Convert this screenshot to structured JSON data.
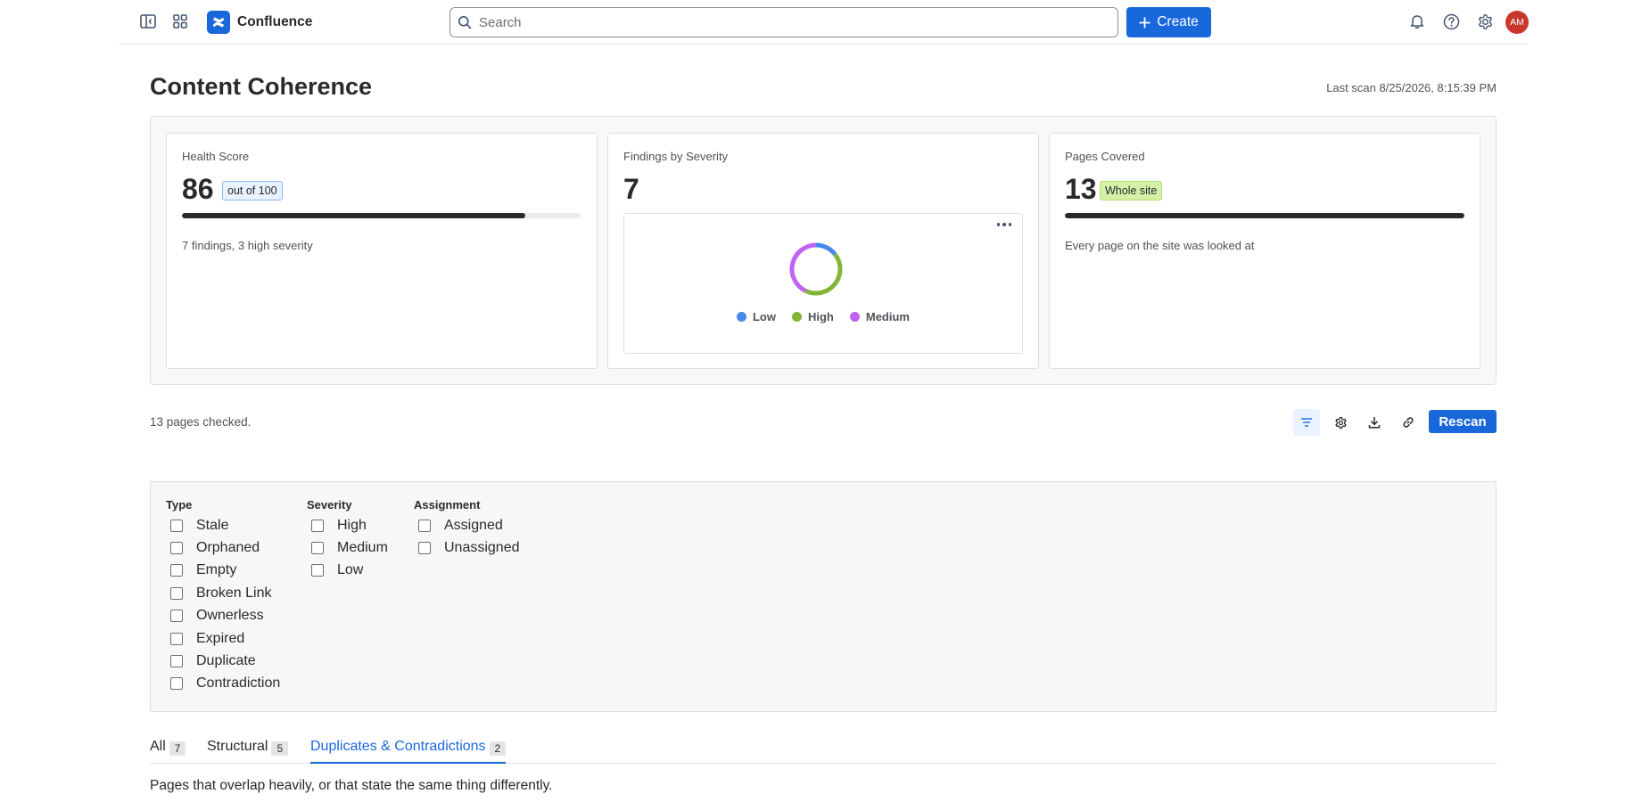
{
  "app": {
    "name": "Confluence",
    "search_placeholder": "Search",
    "create_label": "Create",
    "avatar_initials": "AM",
    "brand_color": "#1868db"
  },
  "header": {
    "title": "Content Coherence",
    "last_scan": "Last scan 8/25/2026, 8:15:39 PM"
  },
  "cards": {
    "health": {
      "label": "Health Score",
      "value": "86",
      "badge": "out of 100",
      "progress_fraction": 0.86,
      "caption": "7 findings, 3 high severity"
    },
    "findings": {
      "label": "Findings by Severity",
      "value": "7"
    },
    "pages": {
      "label": "Pages Covered",
      "value": "13",
      "badge": "Whole site",
      "progress_fraction": 1.0,
      "caption": "Every page on the site was looked at"
    }
  },
  "chart_data": {
    "type": "pie",
    "donut": true,
    "categories": [
      "Low",
      "High",
      "Medium"
    ],
    "values": [
      1,
      3,
      3
    ],
    "colors": [
      "#4688ec",
      "#82b536",
      "#bf63f3"
    ],
    "legend_placement": "bottom"
  },
  "toolbar": {
    "pages_checked": "13 pages checked.",
    "rescan_label": "Rescan"
  },
  "filters": {
    "type": {
      "title": "Type",
      "options": [
        "Stale",
        "Orphaned",
        "Empty",
        "Broken Link",
        "Ownerless",
        "Expired",
        "Duplicate",
        "Contradiction"
      ]
    },
    "severity": {
      "title": "Severity",
      "options": [
        "High",
        "Medium",
        "Low"
      ]
    },
    "assignment": {
      "title": "Assignment",
      "options": [
        "Assigned",
        "Unassigned"
      ]
    }
  },
  "tabs": [
    {
      "label": "All",
      "count": "7"
    },
    {
      "label": "Structural",
      "count": "5"
    },
    {
      "label": "Duplicates & Contradictions",
      "count": "2"
    }
  ],
  "tab_description": "Pages that overlap heavily, or that state the same thing differently."
}
